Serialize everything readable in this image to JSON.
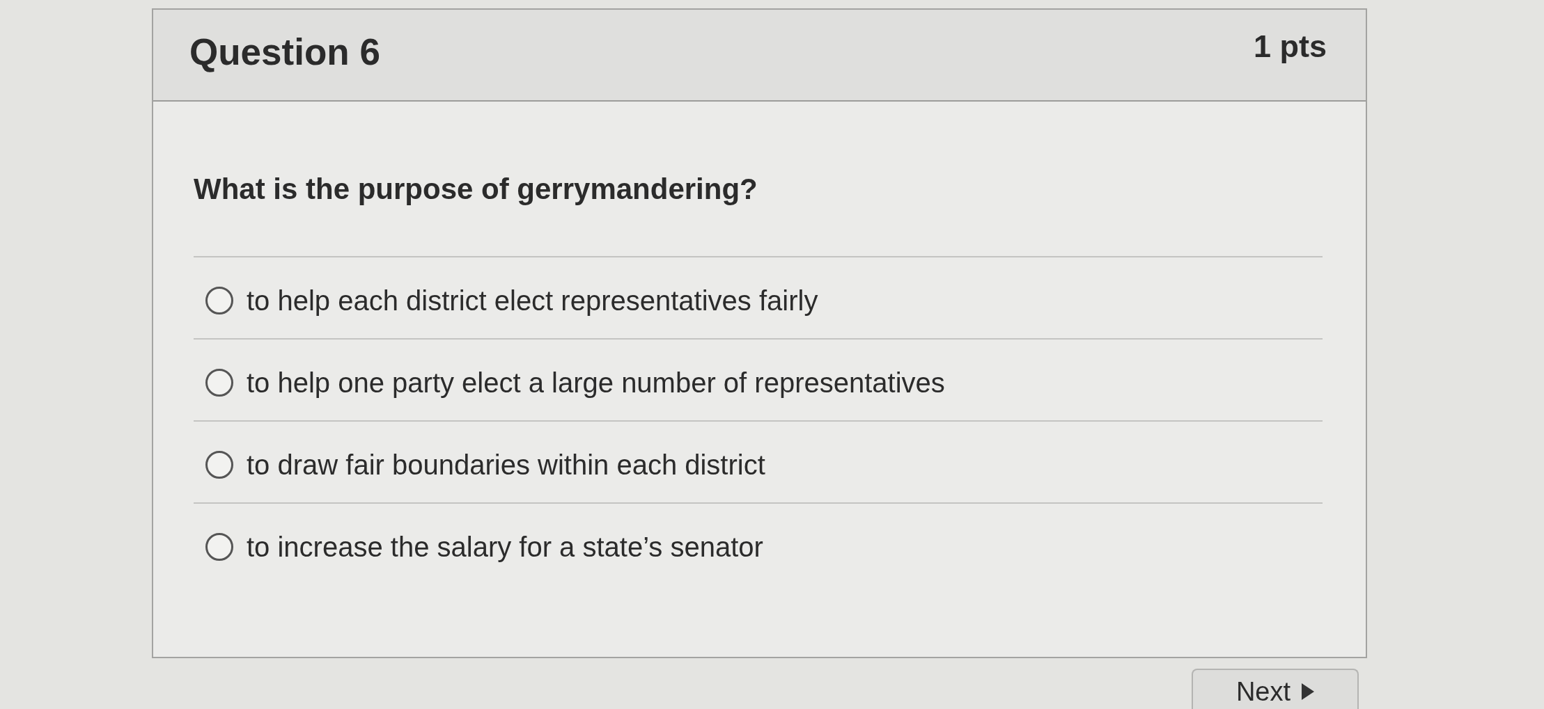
{
  "question": {
    "title": "Question 6",
    "points": "1 pts",
    "text": "What is the purpose of gerrymandering?"
  },
  "options": [
    {
      "label": "to help each district elect representatives fairly",
      "selected": false
    },
    {
      "label": "to help one party elect a large number of representatives",
      "selected": false
    },
    {
      "label": "to draw fair boundaries within each district",
      "selected": false
    },
    {
      "label": "to increase the salary for a state’s senator",
      "selected": false
    }
  ],
  "next_button": {
    "label": "Next"
  }
}
